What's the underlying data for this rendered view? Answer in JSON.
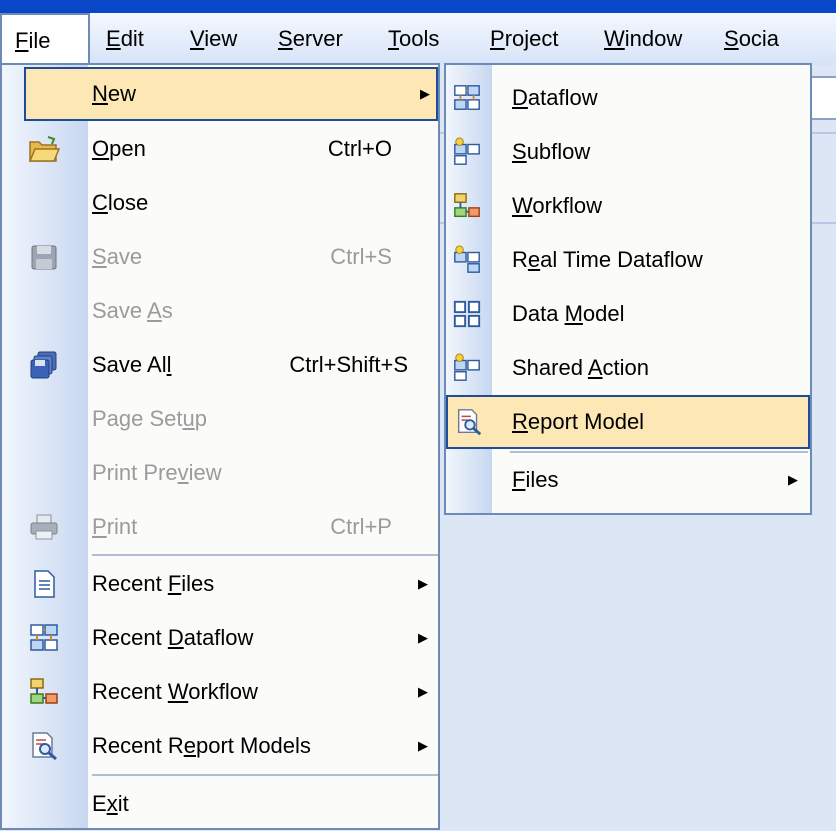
{
  "menubar": [
    {
      "pre": "",
      "u": "F",
      "post": "ile",
      "active": true
    },
    {
      "pre": "",
      "u": "E",
      "post": "dit"
    },
    {
      "pre": "",
      "u": "V",
      "post": "iew"
    },
    {
      "pre": "",
      "u": "S",
      "post": "erver"
    },
    {
      "pre": "",
      "u": "T",
      "post": "ools"
    },
    {
      "pre": "",
      "u": "P",
      "post": "roject"
    },
    {
      "pre": "",
      "u": "W",
      "post": "indow"
    },
    {
      "pre": "",
      "u": "S",
      "post": "ocia"
    }
  ],
  "file_menu": {
    "items": [
      {
        "pre": "",
        "u": "N",
        "post": "ew",
        "shortcut": "",
        "arrow": true,
        "highlight": true,
        "disabled": false,
        "icon": ""
      },
      {
        "pre": "",
        "u": "O",
        "post": "pen",
        "shortcut": "Ctrl+O",
        "disabled": false,
        "icon": "open-folder-icon"
      },
      {
        "pre": "",
        "u": "C",
        "post": "lose",
        "shortcut": "",
        "disabled": false,
        "icon": ""
      },
      {
        "pre": "",
        "u": "S",
        "post": "ave",
        "shortcut": "Ctrl+S",
        "disabled": true,
        "icon": "save-disk-icon"
      },
      {
        "pre": "Save ",
        "u": "A",
        "post": "s",
        "shortcut": "",
        "disabled": true,
        "icon": ""
      },
      {
        "pre": "Save Al",
        "u": "l",
        "post": "",
        "shortcut": "Ctrl+Shift+S",
        "disabled": false,
        "icon": "save-all-icon"
      },
      {
        "pre": "Page Set",
        "u": "u",
        "post": "p",
        "shortcut": "",
        "disabled": true,
        "icon": ""
      },
      {
        "pre": "Print Pre",
        "u": "v",
        "post": "iew",
        "shortcut": "",
        "disabled": true,
        "icon": ""
      },
      {
        "pre": "",
        "u": "P",
        "post": "rint",
        "shortcut": "Ctrl+P",
        "disabled": true,
        "icon": "printer-icon"
      },
      {
        "pre": "Recent ",
        "u": "F",
        "post": "iles",
        "shortcut": "",
        "arrow": true,
        "disabled": false,
        "icon": "document-icon"
      },
      {
        "pre": "Recent ",
        "u": "D",
        "post": "ataflow",
        "shortcut": "",
        "arrow": true,
        "disabled": false,
        "icon": "dataflow-icon"
      },
      {
        "pre": "Recent ",
        "u": "W",
        "post": "orkflow",
        "shortcut": "",
        "arrow": true,
        "disabled": false,
        "icon": "workflow-icon"
      },
      {
        "pre": "Recent R",
        "u": "e",
        "post": "port Models",
        "shortcut": "",
        "arrow": true,
        "disabled": false,
        "icon": "report-model-icon"
      },
      {
        "pre": "E",
        "u": "x",
        "post": "it",
        "shortcut": "",
        "disabled": false,
        "icon": ""
      }
    ]
  },
  "sub_menu": {
    "items": [
      {
        "pre": "",
        "u": "D",
        "post": "ataflow",
        "icon": "dataflow-icon"
      },
      {
        "pre": "",
        "u": "S",
        "post": "ubflow",
        "icon": "subflow-icon"
      },
      {
        "pre": "",
        "u": "W",
        "post": "orkflow",
        "icon": "workflow-icon"
      },
      {
        "pre": "R",
        "u": "e",
        "post": "al Time Dataflow",
        "icon": "realtime-dataflow-icon"
      },
      {
        "pre": "Data ",
        "u": "M",
        "post": "odel",
        "icon": "data-model-icon"
      },
      {
        "pre": "Shared ",
        "u": "A",
        "post": "ction",
        "icon": "shared-action-icon"
      },
      {
        "pre": "",
        "u": "R",
        "post": "eport Model",
        "icon": "report-model-icon",
        "highlight": true
      },
      {
        "pre": "",
        "u": "F",
        "post": "iles",
        "icon": "",
        "arrow": true
      }
    ]
  }
}
